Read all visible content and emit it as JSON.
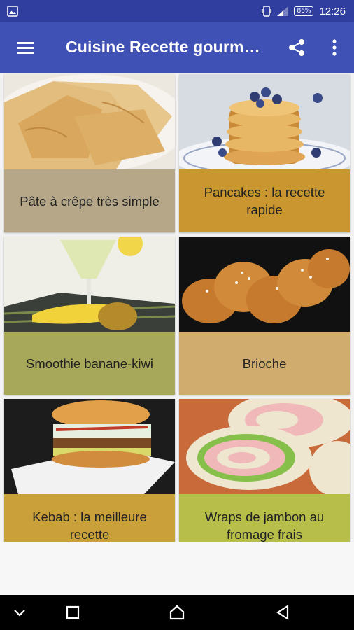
{
  "status_bar": {
    "battery": "86%",
    "time": "12:26"
  },
  "app_bar": {
    "title": "Cuisine Recette gourm…",
    "color": "#3f51b5"
  },
  "recipes": [
    {
      "label": "Pâte à crêpe très simple",
      "label_color": "#b5a787"
    },
    {
      "label": "Pancakes : la recette rapide",
      "label_color": "#c9962f"
    },
    {
      "label": "Smoothie banane-kiwi",
      "label_color": "#a7a85a"
    },
    {
      "label": "Brioche",
      "label_color": "#d1ac6f"
    },
    {
      "label": "Kebab : la meilleure recette",
      "label_color": "#c9a03a"
    },
    {
      "label": "Wraps de jambon au fromage frais",
      "label_color": "#b7bf4a"
    }
  ]
}
